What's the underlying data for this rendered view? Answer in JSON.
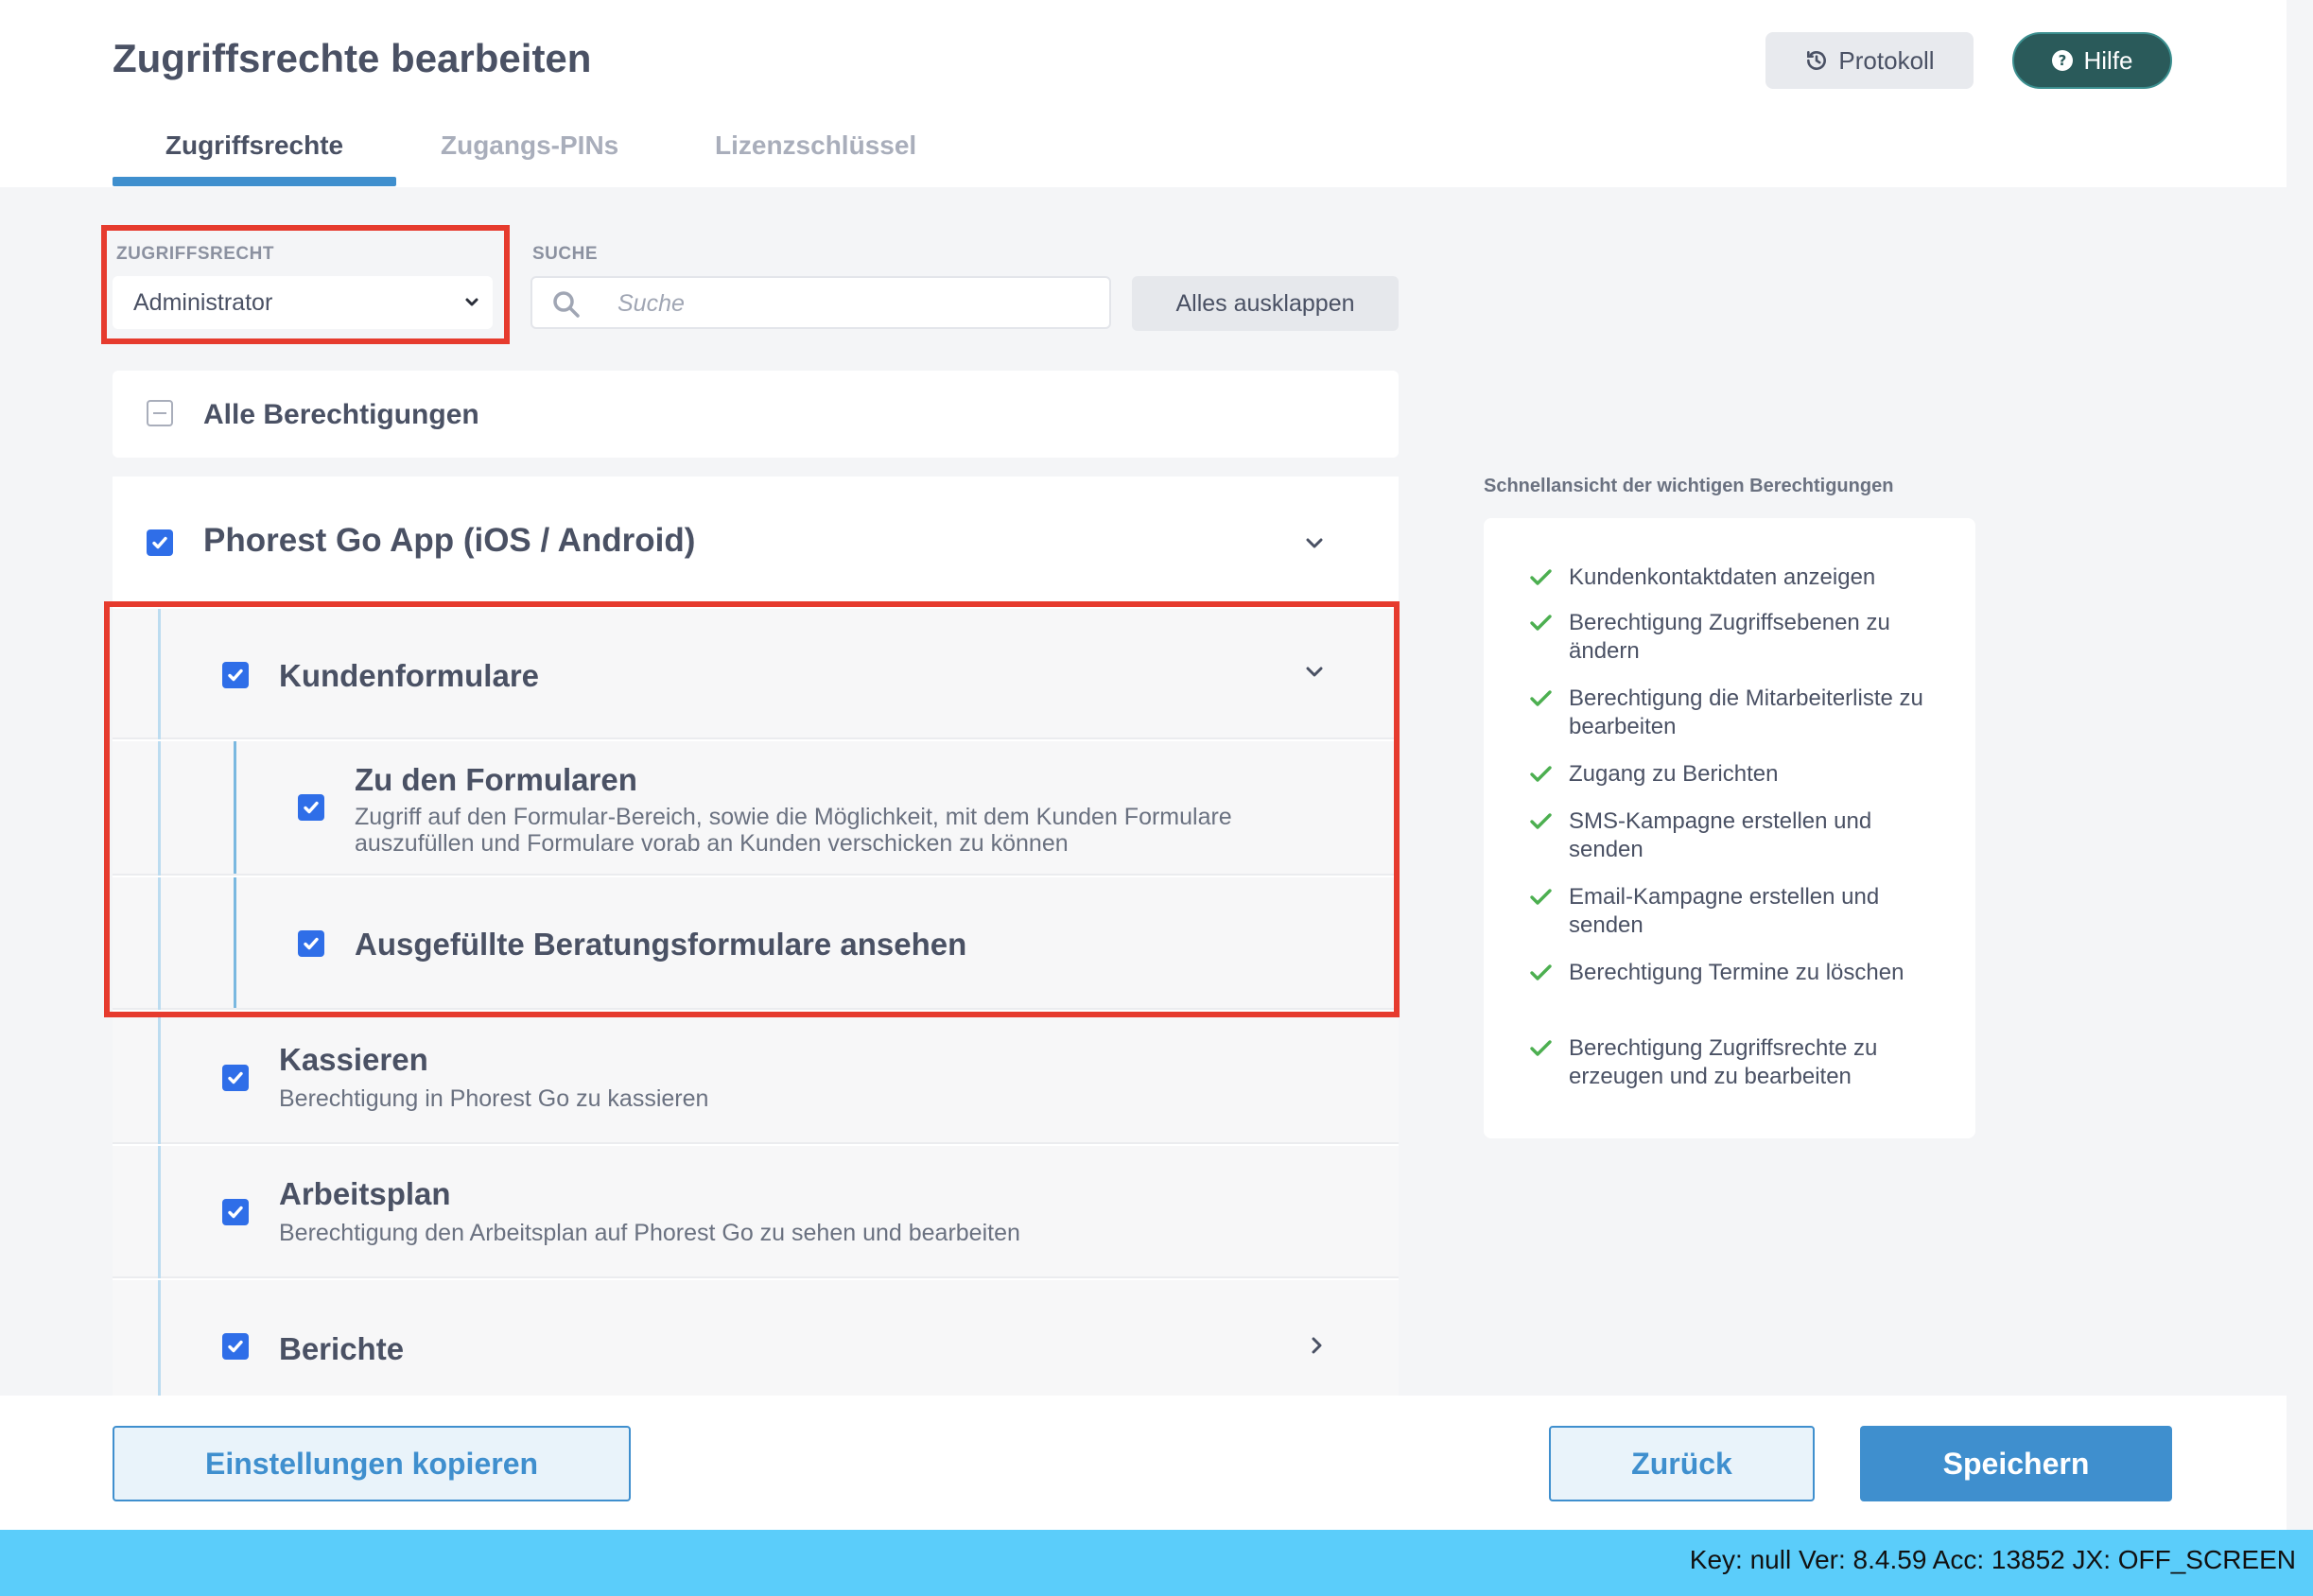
{
  "header": {
    "title": "Zugriffsrechte bearbeiten",
    "protokoll_label": "Protokoll",
    "hilfe_label": "Hilfe"
  },
  "tabs": [
    {
      "label": "Zugriffsrechte",
      "active": true
    },
    {
      "label": "Zugangs-PINs",
      "active": false
    },
    {
      "label": "Lizenzschlüssel",
      "active": false
    }
  ],
  "filters": {
    "role_label": "ZUGRIFFSRECHT",
    "role_value": "Administrator",
    "search_label": "SUCHE",
    "search_placeholder": "Suche",
    "expand_all_label": "Alles ausklappen"
  },
  "permissions": {
    "all_label": "Alle Berechtigungen",
    "app": {
      "title": "Phorest Go App (iOS / Android)",
      "children": [
        {
          "title": "Kundenformulare"
        },
        {
          "title": "Zu den Formularen",
          "description": "Zugriff auf den Formular-Bereich, sowie die Möglichkeit, mit dem Kunden Formulare auszufüllen und Formulare vorab an Kunden verschicken zu können"
        },
        {
          "title": "Ausgefüllte Beratungsformulare ansehen"
        },
        {
          "title": "Kassieren",
          "description": "Berechtigung in Phorest Go zu kassieren"
        },
        {
          "title": "Arbeitsplan",
          "description": "Berechtigung den Arbeitsplan auf Phorest Go zu sehen und bearbeiten"
        },
        {
          "title": "Berichte"
        }
      ]
    }
  },
  "quick_view": {
    "title": "Schnellansicht der wichtigen Berechtigungen",
    "items": [
      "Kundenkontaktdaten anzeigen",
      "Berechtigung Zugriffsebenen zu ändern",
      "Berechtigung die Mitarbeiterliste zu bearbeiten",
      "Zugang zu Berichten",
      "SMS-Kampagne erstellen und senden",
      "Email-Kampagne erstellen und senden",
      "Berechtigung Termine zu löschen",
      "Berechtigung Zugriffsrechte zu erzeugen und zu bearbeiten"
    ]
  },
  "footer": {
    "copy_label": "Einstellungen kopieren",
    "back_label": "Zurück",
    "save_label": "Speichern"
  },
  "status_bar": {
    "text": "Key: null Ver: 8.4.59 Acc: 13852  JX: OFF_SCREEN"
  },
  "colors": {
    "accent": "#3f8fce",
    "checkbox": "#2f6ee8",
    "highlight": "#e63b2e",
    "check_green": "#4caf50",
    "help_button": "#2a5a5a",
    "status_bar": "#5bcdfa"
  }
}
